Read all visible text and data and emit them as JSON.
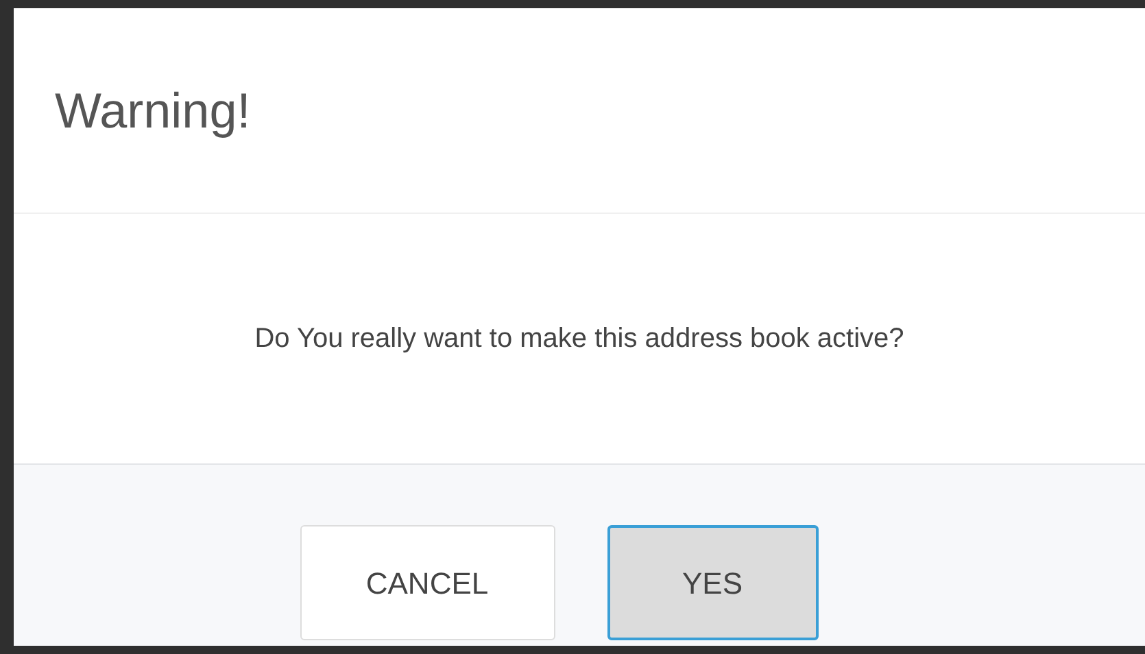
{
  "dialog": {
    "title": "Warning!",
    "message": "Do You really want to make this address book active?",
    "buttons": [
      {
        "label": "CANCEL",
        "selected": false
      },
      {
        "label": "YES",
        "selected": true
      }
    ]
  }
}
